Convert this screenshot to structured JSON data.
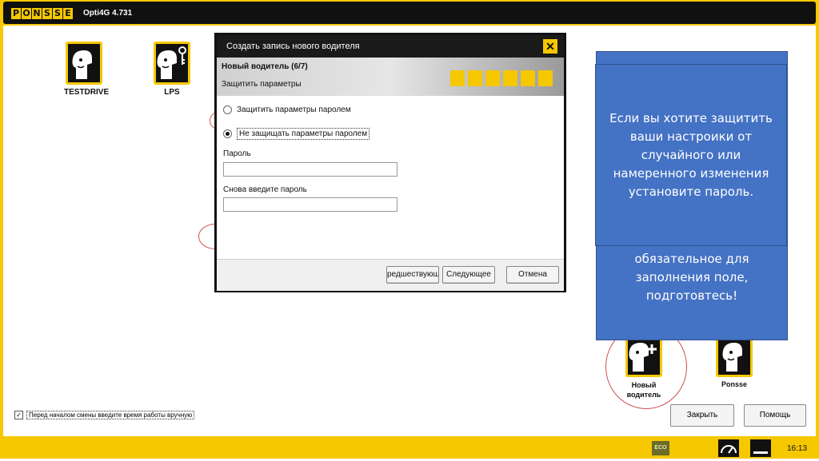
{
  "app": {
    "logo": [
      "P",
      "O",
      "N",
      "S",
      "S",
      "E"
    ],
    "title": "Opti4G 4.731"
  },
  "profiles": [
    {
      "name": "TESTDRIVE",
      "icon": "person-icon"
    },
    {
      "name": "LPS",
      "icon": "person-key-icon"
    }
  ],
  "dialog": {
    "title": "Создать запись нового водителя",
    "close_glyph": "✕",
    "step": "Новый водитель (6/7)",
    "subtitle": "Защитить параметры",
    "option_protect": "Защитить параметры паролем",
    "option_no_protect": "Не защищать параметры паролем",
    "selected_option": "no_protect",
    "password_label": "Пароль",
    "password_value": "",
    "repeat_label": "Снова введите пароль",
    "repeat_value": "",
    "btn_prev": "редшествующи",
    "btn_next": "Следующее",
    "btn_cancel": "Отмена"
  },
  "callout_back": {
    "lines": [
      "обязательное для",
      "заполнения поле,",
      "подготовтесь!"
    ]
  },
  "callout_front": {
    "lines": [
      "Если вы хотите защитить",
      "ваши настроики от",
      "случайного или",
      "намеренного изменения",
      "установите пароль."
    ]
  },
  "driver_new": {
    "line1": "Новый",
    "line2": "водитель"
  },
  "driver_ponsse": {
    "label": "Ponsse"
  },
  "manual_time": {
    "checked": true,
    "label": "Перед началом смены введите время работы вручную"
  },
  "buttons": {
    "close": "Закрыть",
    "help": "Помощь"
  },
  "statusbar": {
    "eco": "ECO",
    "time": "16:13"
  },
  "colors": {
    "brand_yellow": "#f5c800",
    "callout_blue": "#4472c4",
    "highlight_red": "#d05050"
  }
}
